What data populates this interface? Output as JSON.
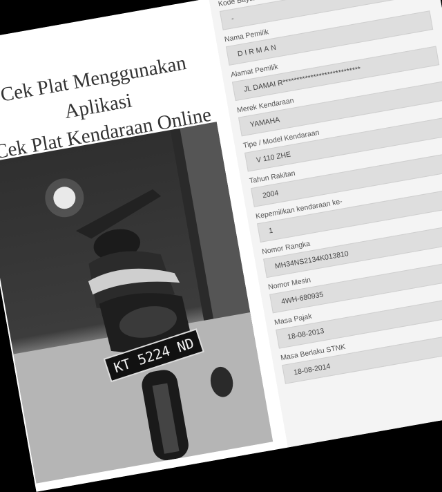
{
  "headline": {
    "line1": "Cek Plat Menggunakan Aplikasi",
    "line2": "Cek Plat Kendaraan Online"
  },
  "photo": {
    "plate_text": "KT 5224 ND"
  },
  "form": {
    "fields": [
      {
        "label": "Kode Bayar",
        "value": "-"
      },
      {
        "label": "Nama Pemilik",
        "value": "DIRMAN"
      },
      {
        "label": "Alamat Pemilik",
        "value": "JL DAMAI R****************************"
      },
      {
        "label": "Merek Kendaraan",
        "value": "YAMAHA"
      },
      {
        "label": "Tipe / Model Kendaraan",
        "value": "V 110 ZHE"
      },
      {
        "label": "Tahun Rakitan",
        "value": "2004"
      },
      {
        "label": "Kepemilikan kendaraan ke-",
        "value": "1"
      },
      {
        "label": "Nomor Rangka",
        "value": "MH34NS2134K013810"
      },
      {
        "label": "Nomor Mesin",
        "value": "4WH-680935"
      },
      {
        "label": "Masa Pajak",
        "value": "18-08-2013"
      },
      {
        "label": "Masa Berlaku STNK",
        "value": "18-08-2014"
      }
    ]
  }
}
